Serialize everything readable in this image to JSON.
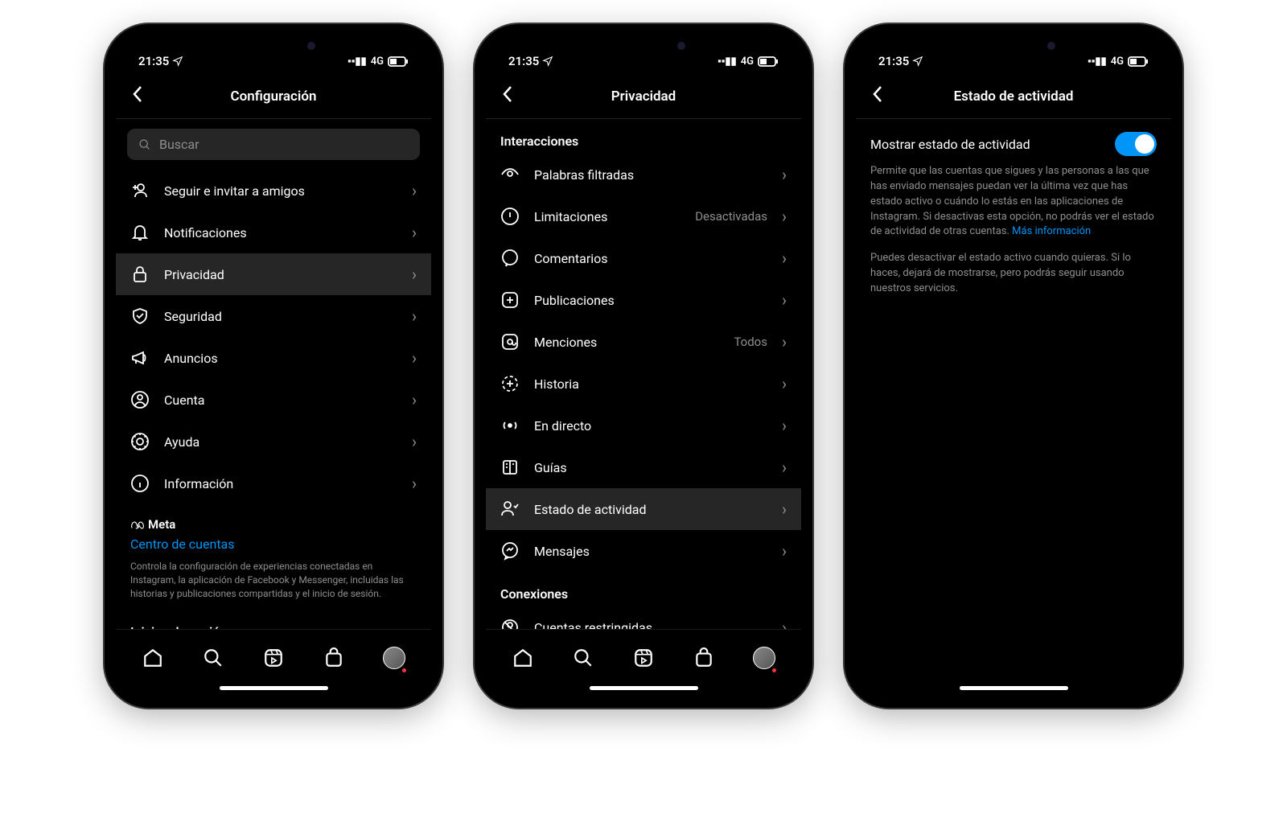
{
  "status": {
    "time": "21:35",
    "network": "4G"
  },
  "screen1": {
    "title": "Configuración",
    "search_placeholder": "Buscar",
    "items": [
      {
        "icon": "user-plus-icon",
        "label": "Seguir e invitar a amigos"
      },
      {
        "icon": "bell-icon",
        "label": "Notificaciones"
      },
      {
        "icon": "lock-icon",
        "label": "Privacidad",
        "highlighted": true
      },
      {
        "icon": "shield-icon",
        "label": "Seguridad"
      },
      {
        "icon": "megaphone-icon",
        "label": "Anuncios"
      },
      {
        "icon": "account-icon",
        "label": "Cuenta"
      },
      {
        "icon": "help-icon",
        "label": "Ayuda"
      },
      {
        "icon": "info-icon",
        "label": "Información"
      }
    ],
    "meta_label": "Meta",
    "meta_link": "Centro de cuentas",
    "meta_desc": "Controla la configuración de experiencias conectadas en Instagram, la aplicación de Facebook y Messenger, incluidas las historias y publicaciones compartidas y el inicio de sesión.",
    "logins_title": "Inicios de sesión"
  },
  "screen2": {
    "title": "Privacidad",
    "section1": "Interacciones",
    "items": [
      {
        "icon": "eye-icon",
        "label": "Palabras filtradas"
      },
      {
        "icon": "alert-icon",
        "label": "Limitaciones",
        "value": "Desactivadas"
      },
      {
        "icon": "comment-icon",
        "label": "Comentarios"
      },
      {
        "icon": "plus-square-icon",
        "label": "Publicaciones"
      },
      {
        "icon": "at-icon",
        "label": "Menciones",
        "value": "Todos"
      },
      {
        "icon": "story-icon",
        "label": "Historia"
      },
      {
        "icon": "live-icon",
        "label": "En directo"
      },
      {
        "icon": "guides-icon",
        "label": "Guías"
      },
      {
        "icon": "activity-icon",
        "label": "Estado de actividad",
        "highlighted": true
      },
      {
        "icon": "messenger-icon",
        "label": "Mensajes"
      }
    ],
    "section2": "Conexiones",
    "items2": [
      {
        "icon": "restricted-icon",
        "label": "Cuentas restringidas"
      }
    ]
  },
  "screen3": {
    "title": "Estado de actividad",
    "toggle_label": "Mostrar estado de actividad",
    "toggle_on": true,
    "desc1": "Permite que las cuentas que sigues y las personas a las que has enviado mensajes puedan ver la última vez que has estado activo o cuándo lo estás en las aplicaciones de Instagram. Si desactivas esta opción, no podrás ver el estado de actividad de otras cuentas.",
    "more_info": "Más información",
    "desc2": "Puedes desactivar el estado activo cuando quieras. Si lo haces, dejará de mostrarse, pero podrás seguir usando nuestros servicios."
  }
}
